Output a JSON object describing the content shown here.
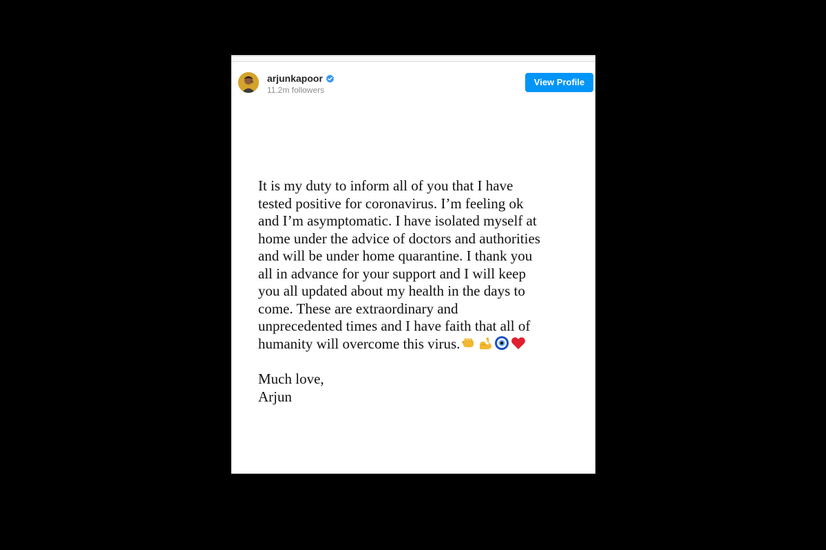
{
  "profile": {
    "username": "arjunkapoor",
    "followers": "11.2m followers",
    "view_profile_label": "View Profile",
    "verified": true
  },
  "post": {
    "message": "It is my duty to inform all of you that I have\ntested positive for coronavirus. I’m feeling ok\nand I’m asymptomatic. I have isolated myself at\nhome under the advice of doctors and authorities\nand will be under home quarantine. I thank you\nall in advance for your support and I will keep\nyou all updated about my health in the days to\ncome. These are extraordinary and\nunprecedented times and I have faith that all of\nhumanity will overcome this virus.",
    "emojis": [
      "fist-icon",
      "flexed-biceps-icon",
      "nazar-amulet-icon",
      "red-heart-icon"
    ],
    "signoff_line1": "Much love,",
    "signoff_line2": "Arjun"
  },
  "colors": {
    "background": "#000000",
    "card": "#ffffff",
    "button": "#0095f6",
    "verified": "#3897f0"
  }
}
